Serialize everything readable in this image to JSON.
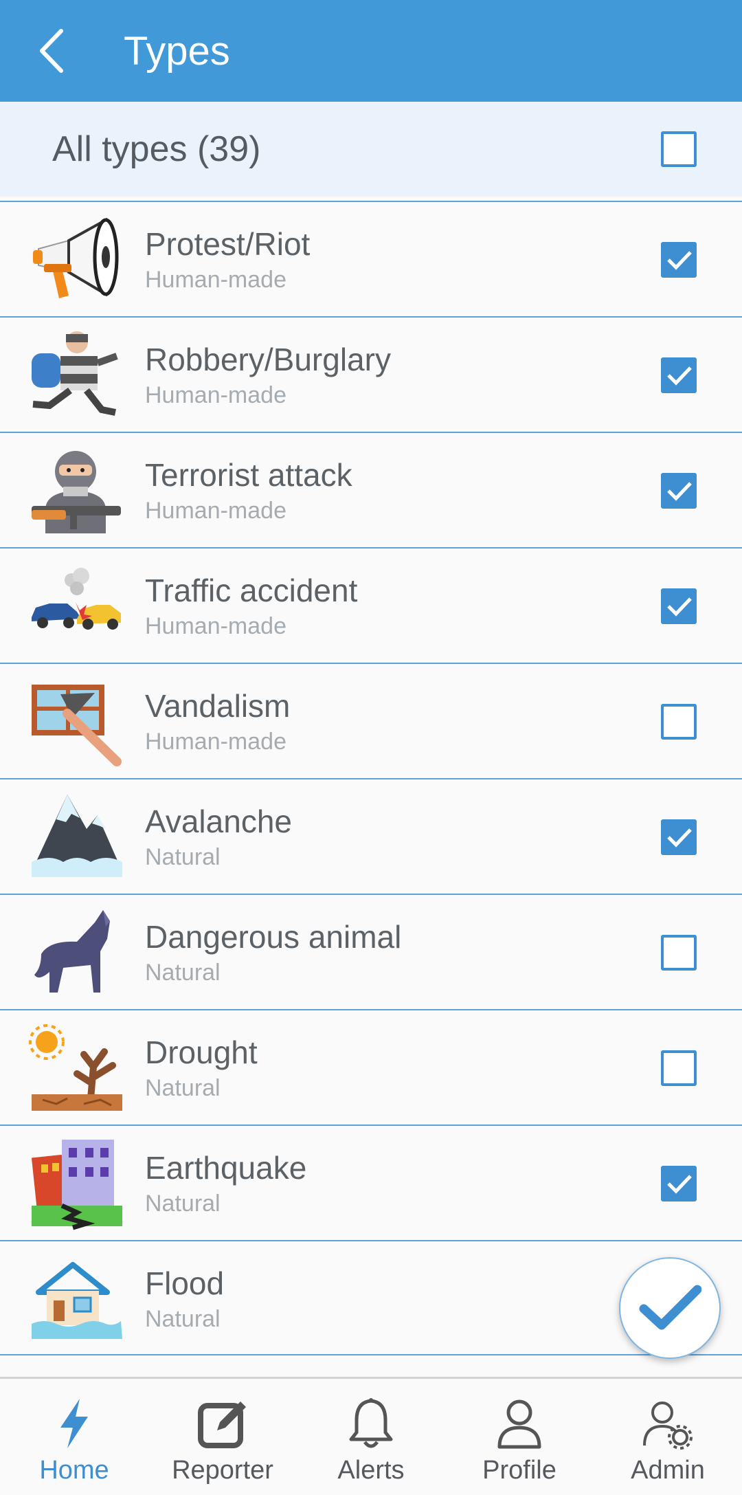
{
  "header": {
    "title": "Types"
  },
  "all_types": {
    "label": "All types (39)",
    "checked": false
  },
  "items": [
    {
      "title": "Protest/Riot",
      "category": "Human-made",
      "icon": "megaphone-icon",
      "checked": true
    },
    {
      "title": "Robbery/Burglary",
      "category": "Human-made",
      "icon": "robber-icon",
      "checked": true
    },
    {
      "title": "Terrorist attack",
      "category": "Human-made",
      "icon": "terrorist-icon",
      "checked": true
    },
    {
      "title": "Traffic accident",
      "category": "Human-made",
      "icon": "car-crash-icon",
      "checked": true
    },
    {
      "title": "Vandalism",
      "category": "Human-made",
      "icon": "broken-window-icon",
      "checked": false
    },
    {
      "title": "Avalanche",
      "category": "Natural",
      "icon": "mountain-icon",
      "checked": true
    },
    {
      "title": "Dangerous animal",
      "category": "Natural",
      "icon": "wolf-icon",
      "checked": false
    },
    {
      "title": "Drought",
      "category": "Natural",
      "icon": "dry-tree-icon",
      "checked": false
    },
    {
      "title": "Earthquake",
      "category": "Natural",
      "icon": "cracked-building-icon",
      "checked": true
    },
    {
      "title": "Flood",
      "category": "Natural",
      "icon": "flooded-house-icon",
      "checked": false
    }
  ],
  "nav": {
    "home": "Home",
    "reporter": "Reporter",
    "alerts": "Alerts",
    "profile": "Profile",
    "admin": "Admin"
  },
  "colors": {
    "primary": "#4299d8",
    "checkbox": "#3d8fd1",
    "divider": "#5aa3db"
  }
}
